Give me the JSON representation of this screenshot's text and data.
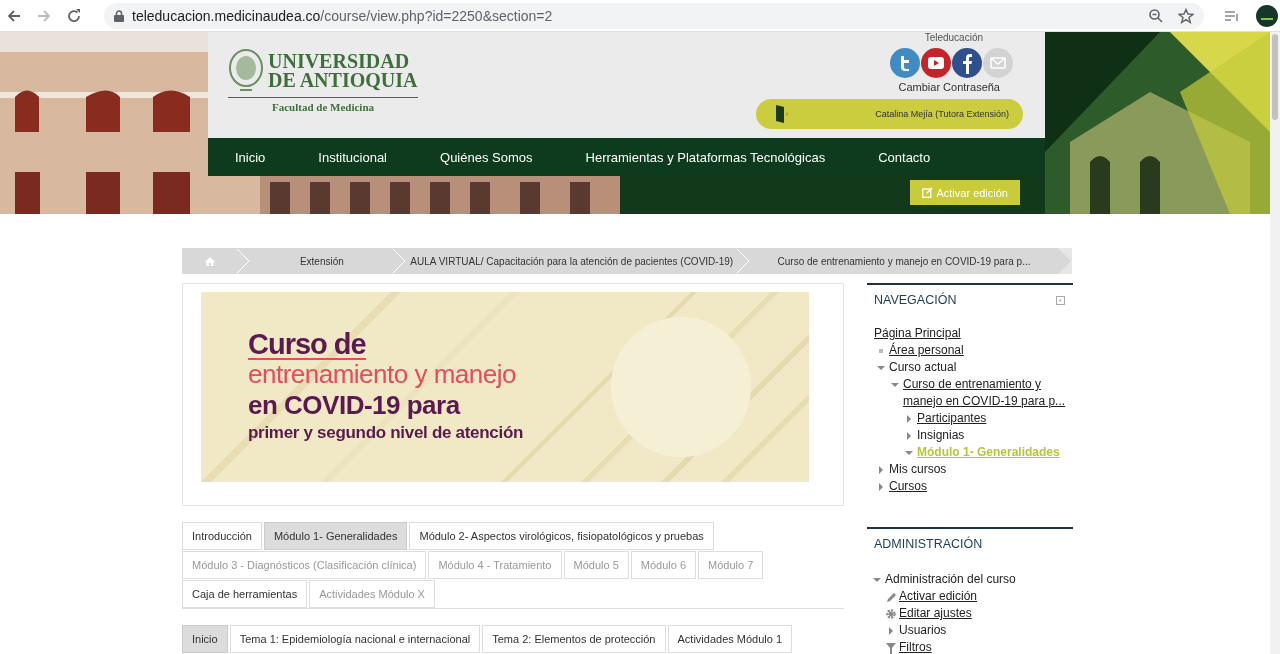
{
  "browser": {
    "url_host": "teleducacion.medicinaudea.co",
    "url_path": "/course/view.php?id=2250&section=2"
  },
  "header": {
    "university": [
      "UNIVERSIDAD",
      "DE ANTIOQUIA"
    ],
    "faculty": "Facultad de Medicina",
    "site_label": "Teleducación",
    "change_password": "Cambiar Contraseña",
    "user": "Catalina Mejía (Tutora Extensión)",
    "menu": [
      "Inicio",
      "Institucional",
      "Quiénes Somos",
      "Herramientas y Plataformas Tecnológicas",
      "Contacto"
    ],
    "edit_button": "Activar edición"
  },
  "breadcrumb": [
    "Extensión",
    "AULA VIRTUAL/ Capacitación para la atención de pacientes (COVID-19)",
    "Curso de entrenamiento y manejo en COVID-19 para p..."
  ],
  "banner": {
    "lines": [
      {
        "kind": "title",
        "text": "Curso de"
      },
      {
        "kind": "accent",
        "text": "entrenamiento y manejo"
      },
      {
        "kind": "mixed",
        "text": "en **COVID-19** para"
      },
      {
        "kind": "subtitle",
        "text": "primer y segundo nivel de atención"
      }
    ]
  },
  "section_tabs": [
    {
      "label": "Introducción",
      "selected": false,
      "disabled": false
    },
    {
      "label": "Módulo 1- Generalidades",
      "selected": true,
      "disabled": false
    },
    {
      "label": "Módulo 2- Aspectos virológicos, fisiopatológicos y pruebas",
      "selected": false,
      "disabled": false
    },
    {
      "label": "Módulo 3 - Diagnósticos (Clasificación clínica)",
      "selected": false,
      "disabled": true
    },
    {
      "label": "Módulo 4 - Tratamiento",
      "selected": false,
      "disabled": true
    },
    {
      "label": "Módulo 5",
      "selected": false,
      "disabled": true
    },
    {
      "label": "Módulo 6",
      "selected": false,
      "disabled": true
    },
    {
      "label": "Módulo 7",
      "selected": false,
      "disabled": true
    },
    {
      "label": "Caja de herramientas",
      "selected": false,
      "disabled": false
    },
    {
      "label": "Actividades Módulo X",
      "selected": false,
      "disabled": true
    }
  ],
  "topic_tabs": [
    {
      "label": "Inicio",
      "selected": true
    },
    {
      "label": "Tema 1: Epidemiología nacional e internacional",
      "selected": false
    },
    {
      "label": "Tema 2: Elementos de protección",
      "selected": false
    },
    {
      "label": "Actividades Módulo 1",
      "selected": false
    }
  ],
  "navigation": {
    "title": "NAVEGACIÓN",
    "items": [
      {
        "label": "Página Principal",
        "kind": "root",
        "link": true,
        "selected": false,
        "children": [
          {
            "label": "Área personal",
            "kind": "leaf",
            "link": true,
            "selected": false
          },
          {
            "label": "Curso actual",
            "kind": "branch",
            "expanded": true,
            "link": false,
            "selected": false,
            "children": [
              {
                "label": "Curso de entrenamiento y manejo en COVID-19 para p...",
                "kind": "branch",
                "expanded": true,
                "link": true,
                "selected": false,
                "children": [
                  {
                    "label": "Participantes",
                    "kind": "branch",
                    "expanded": false,
                    "link": true,
                    "selected": false
                  },
                  {
                    "label": "Insignias",
                    "kind": "branch",
                    "expanded": false,
                    "link": false,
                    "selected": false
                  },
                  {
                    "label": "Módulo 1- Generalidades",
                    "kind": "branch",
                    "expanded": true,
                    "link": true,
                    "selected": true
                  }
                ]
              }
            ]
          },
          {
            "label": "Mis cursos",
            "kind": "branch",
            "expanded": false,
            "link": false,
            "selected": false
          },
          {
            "label": "Cursos",
            "kind": "branch",
            "expanded": false,
            "link": true,
            "selected": false
          }
        ]
      }
    ]
  },
  "administration": {
    "title": "ADMINISTRACIÓN",
    "items": [
      {
        "label": "Administración del curso",
        "kind": "branch",
        "expanded": true,
        "link": false,
        "children": [
          {
            "label": "Activar edición",
            "kind": "edit",
            "link": true
          },
          {
            "label": "Editar ajustes",
            "kind": "settings",
            "link": true
          },
          {
            "label": "Usuarios",
            "kind": "branch",
            "expanded": false,
            "link": false
          },
          {
            "label": "Filtros",
            "kind": "filter",
            "link": true
          }
        ]
      }
    ]
  }
}
